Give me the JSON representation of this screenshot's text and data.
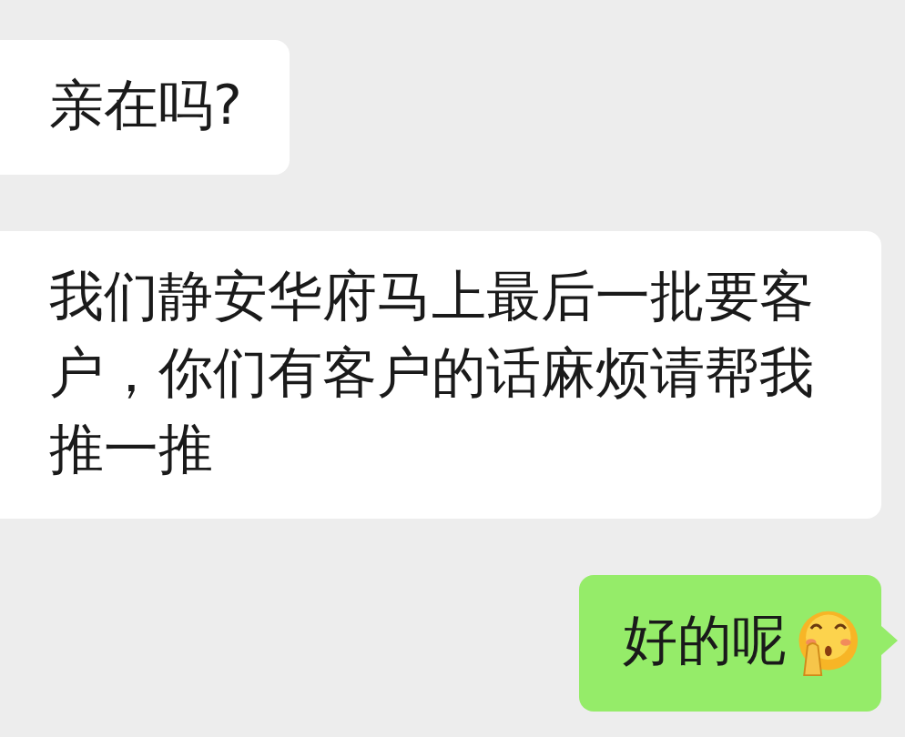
{
  "messages": [
    {
      "kind": "incoming",
      "text": "亲在吗?",
      "emoji": false
    },
    {
      "kind": "incoming",
      "text": "我们静安华府马上最后一批要客户，你们有客户的话麻烦请帮我推一推",
      "emoji": false
    },
    {
      "kind": "outgoing",
      "text": "好的呢",
      "emoji": true
    }
  ]
}
